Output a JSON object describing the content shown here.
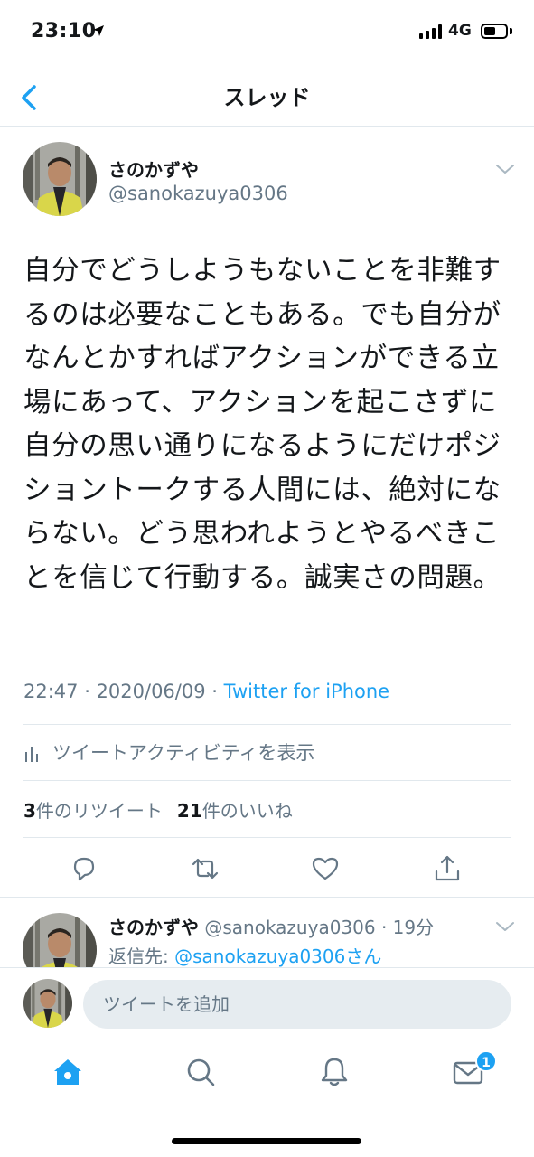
{
  "status_bar": {
    "time": "23:10",
    "network": "4G",
    "battery_level": 0.55
  },
  "header": {
    "title": "スレッド",
    "back_icon": "chevron-left-icon"
  },
  "tweet": {
    "display_name": "さのかずや",
    "handle": "@sanokazuya0306",
    "text": "自分でどうしようもないことを非難するのは必要なこともある。でも自分がなんとかすればアクションができる立場にあって、アクションを起こさずに自分の思い通りになるようにだけポジショントークする人間には、絶対にならない。どう思われようとやるべきことを信じて行動する。誠実さの問題。",
    "timestamp": "22:47 · 2020/06/09 · ",
    "source": "Twitter for iPhone",
    "activity_label": "ツイートアクティビティを表示",
    "retweets_count": "3",
    "retweets_label": "件のリツイート",
    "likes_count": "21",
    "likes_label": "件のいいね"
  },
  "reply": {
    "display_name": "さのかずや",
    "handle_time": "@sanokazuya0306 · 19分",
    "reply_to_prefix": "返信先: ",
    "reply_to_link": "@sanokazuya0306さん"
  },
  "compose": {
    "placeholder": "ツイートを追加"
  },
  "tab_bar": {
    "items": [
      "home-icon",
      "search-icon",
      "notifications-icon",
      "messages-icon"
    ],
    "messages_badge": "1"
  },
  "colors": {
    "accent": "#1da1f2",
    "secondary_text": "#657786",
    "divider": "#e1e8ed"
  }
}
